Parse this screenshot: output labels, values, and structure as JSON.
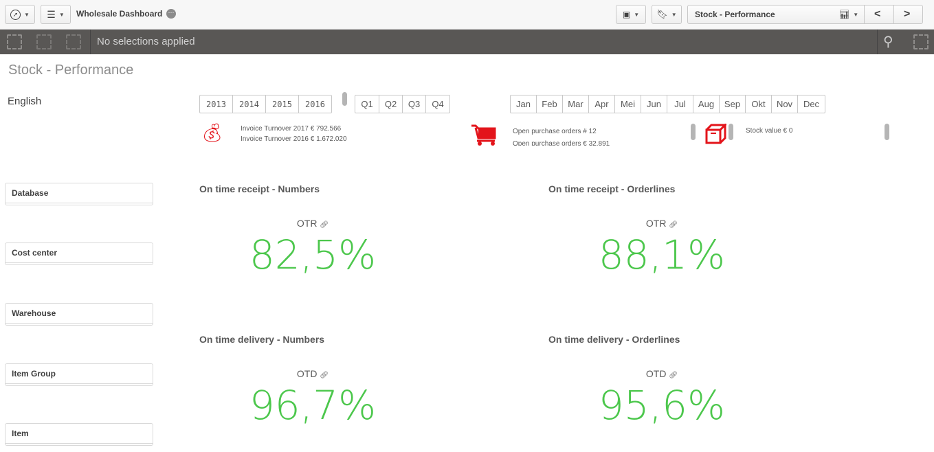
{
  "app": {
    "title": "Wholesale Dashboard",
    "sheet_selector": "Stock - Performance"
  },
  "selections": {
    "status": "No selections applied"
  },
  "sheet": {
    "title": "Stock - Performance",
    "language": "English"
  },
  "filters": {
    "years": [
      "2013",
      "2014",
      "2015",
      "2016"
    ],
    "quarters": [
      "Q1",
      "Q2",
      "Q3",
      "Q4"
    ],
    "months": [
      "Jan",
      "Feb",
      "Mar",
      "Apr",
      "Mei",
      "Jun",
      "Jul",
      "Aug",
      "Sep",
      "Okt",
      "Nov",
      "Dec"
    ]
  },
  "kpis": {
    "invoice": [
      "Invoice Turnover 2017 € 792.566",
      "Invoice Turnover 2016 € 1.672.020"
    ],
    "purchase": [
      "Open purchase orders # 12",
      "Open purchase orders € 32.891"
    ],
    "stock": [
      "Stock value € 0"
    ]
  },
  "listboxes": [
    "Database",
    "Cost center",
    "Warehouse",
    "Item Group",
    "Item"
  ],
  "gauges": [
    {
      "title": "On time receipt - Numbers",
      "label": "OTR",
      "value": "82,5%"
    },
    {
      "title": "On time receipt - Orderlines",
      "label": "OTR",
      "value": "88,1%"
    },
    {
      "title": "On time delivery - Numbers",
      "label": "OTD",
      "value": "96,7%"
    },
    {
      "title": "On time delivery - Orderlines",
      "label": "OTD",
      "value": "95,6%"
    }
  ],
  "colors": {
    "accent_red": "#e3141b",
    "kpi_green": "#4cc74c",
    "selection_bar": "#595755"
  }
}
